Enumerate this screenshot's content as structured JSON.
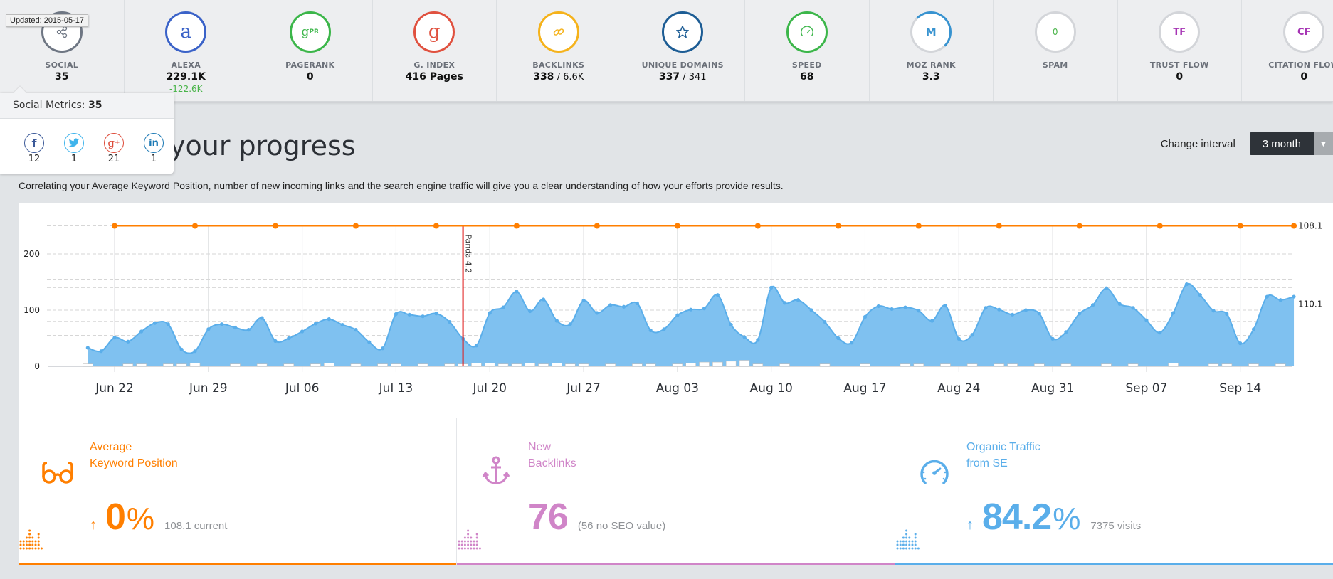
{
  "metrics": [
    {
      "key": "social",
      "label": "SOCIAL",
      "value": "35",
      "sub": "",
      "delta": "",
      "icon": "share-icon",
      "glyph": "⟨",
      "color": "#6e7683"
    },
    {
      "key": "alexa",
      "label": "ALEXA",
      "value": "229.1K",
      "sub": "",
      "delta": "-122.6K",
      "icon": "alexa-icon",
      "glyph": "a",
      "color": "#3a62c8"
    },
    {
      "key": "pagerank",
      "label": "PAGERANK",
      "value": "0",
      "sub": "",
      "delta": "",
      "icon": "pagerank-icon",
      "glyph": "gPR",
      "color": "#3cb64a"
    },
    {
      "key": "gindex",
      "label": "G. INDEX",
      "value": "416 Pages",
      "sub": "",
      "delta": "",
      "icon": "google-icon",
      "glyph": "g",
      "color": "#e0513f"
    },
    {
      "key": "backlinks",
      "label": "BACKLINKS",
      "value": "338",
      "sub": " / 6.6K",
      "delta": "",
      "icon": "link-icon",
      "glyph": "∞",
      "color": "#f5b21b"
    },
    {
      "key": "domains",
      "label": "UNIQUE DOMAINS",
      "value": "337",
      "sub": " / 341",
      "delta": "",
      "icon": "star-icon",
      "glyph": "☆",
      "color": "#1c5c94"
    },
    {
      "key": "speed",
      "label": "SPEED",
      "value": "68",
      "sub": "",
      "delta": "",
      "icon": "speedometer-icon",
      "glyph": "◔",
      "color": "#3cb64a"
    },
    {
      "key": "moz",
      "label": "MOZ RANK",
      "value": "3.3",
      "sub": "",
      "delta": "",
      "icon": "moz-icon",
      "glyph": "M",
      "color": "#3893d0"
    },
    {
      "key": "spam",
      "label": "SPAM",
      "value": "",
      "sub": "",
      "delta": "",
      "icon": "spam-icon",
      "glyph": "0",
      "color": "#49b449"
    },
    {
      "key": "trust",
      "label": "TRUST FLOW",
      "value": "0",
      "sub": "",
      "delta": "",
      "icon": "trust-flow-icon",
      "glyph": "TF",
      "color": "#a634b4"
    },
    {
      "key": "citation",
      "label": "CITATION FLOW",
      "value": "0",
      "sub": "",
      "delta": "",
      "icon": "citation-flow-icon",
      "glyph": "CF",
      "color": "#a634b4"
    }
  ],
  "updated_tooltip": "Updated: 2015-05-17",
  "social_popup": {
    "title": "Social Metrics:",
    "total": "35",
    "networks": [
      {
        "name": "facebook",
        "glyph": "f",
        "count": "12",
        "color": "#3b5998"
      },
      {
        "name": "twitter",
        "glyph": "🐦",
        "count": "1",
        "color": "#3fb4ec"
      },
      {
        "name": "google-plus",
        "glyph": "g+",
        "count": "21",
        "color": "#dd4b39"
      },
      {
        "name": "linkedin",
        "glyph": "in",
        "count": "1",
        "color": "#1a78b4"
      }
    ]
  },
  "page": {
    "title": "Track your progress",
    "title_visible": "your progress",
    "description": "Correlating your Average Keyword Position, number of new incoming links and the search engine traffic will give you a clear understanding of how your efforts provide results.",
    "interval_label": "Change interval",
    "interval_value": "3 month"
  },
  "stats": [
    {
      "key": "keyword",
      "title_line1": "Average",
      "title_line2": "Keyword Position",
      "arrow": "↑",
      "number": "0",
      "pct": "%",
      "note": "108.1 current",
      "color": "#ff7f00",
      "icon": "glasses-icon"
    },
    {
      "key": "backlinks",
      "title_line1": "New",
      "title_line2": "Backlinks",
      "arrow": "",
      "number": "76",
      "pct": "",
      "note": "(56 no SEO value)",
      "color": "#d085c8",
      "icon": "anchor-icon"
    },
    {
      "key": "traffic",
      "title_line1": "Organic Traffic",
      "title_line2": "from SE",
      "arrow": "↑",
      "number": "84.2",
      "pct": "%",
      "note": "7375 visits",
      "color": "#5aaeea",
      "icon": "speedometer-icon"
    }
  ],
  "chart_data": {
    "type": "area",
    "title": "",
    "xlabel": "",
    "ylabel": "",
    "x_tick_labels": [
      "Jun 22",
      "Jun 29",
      "Jul 06",
      "Jul 13",
      "Jul 20",
      "Jul 27",
      "Aug 03",
      "Aug 10",
      "Aug 17",
      "Aug 24",
      "Aug 31",
      "Sep 07",
      "Sep 14"
    ],
    "y_left_ticks": [
      "0",
      "100",
      "200"
    ],
    "y_left_range": [
      0,
      250
    ],
    "y_right_ticks": [
      "108.1",
      "110.1"
    ],
    "grid": true,
    "annotation": {
      "label": "Panda 4.2",
      "x": "Jul 18",
      "color": "#e01a1a"
    },
    "start_date": "Jun 20",
    "series": [
      {
        "name": "Organic Traffic",
        "type": "area",
        "color": "#5aaeea",
        "values": [
          33,
          27,
          51,
          44,
          62,
          77,
          75,
          30,
          27,
          66,
          75,
          69,
          65,
          86,
          45,
          50,
          62,
          76,
          84,
          74,
          65,
          43,
          32,
          93,
          92,
          89,
          94,
          79,
          49,
          37,
          95,
          105,
          133,
          98,
          119,
          81,
          75,
          117,
          95,
          109,
          106,
          112,
          64,
          66,
          91,
          101,
          103,
          127,
          74,
          52,
          47,
          140,
          113,
          118,
          100,
          79,
          50,
          42,
          88,
          107,
          102,
          105,
          99,
          81,
          108,
          49,
          56,
          104,
          101,
          92,
          100,
          94,
          49,
          61,
          94,
          109,
          139,
          111,
          104,
          82,
          60,
          95,
          146,
          127,
          99,
          93,
          41,
          66,
          124,
          118,
          124
        ]
      },
      {
        "name": "Average Keyword Position",
        "type": "line",
        "color": "#ff7f00",
        "value": 108.1,
        "marker_every_days": 6
      },
      {
        "name": "New Backlinks",
        "type": "bar",
        "color": "#ffffff",
        "values": [
          1,
          0,
          0,
          1,
          1,
          0,
          1,
          1,
          2,
          0,
          0,
          1,
          0,
          1,
          0,
          1,
          0,
          1,
          2,
          0,
          1,
          0,
          1,
          1,
          0,
          1,
          0,
          1,
          1,
          2,
          2,
          1,
          1,
          2,
          1,
          2,
          1,
          1,
          0,
          1,
          0,
          1,
          1,
          0,
          1,
          2,
          3,
          3,
          4,
          5,
          1,
          0,
          1,
          0,
          0,
          1,
          0,
          0,
          1,
          0,
          0,
          1,
          1,
          0,
          1,
          0,
          1,
          0,
          1,
          1,
          0,
          1,
          0,
          1,
          0,
          0,
          1,
          0,
          1,
          0,
          0,
          2,
          0,
          0,
          1,
          1,
          0,
          1,
          0,
          1,
          0
        ]
      }
    ]
  }
}
